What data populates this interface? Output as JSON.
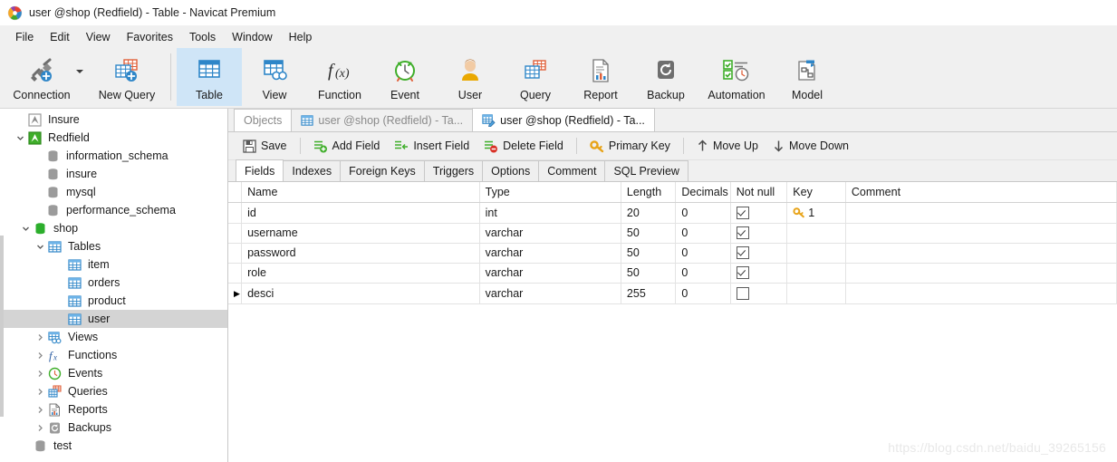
{
  "window": {
    "title": "user @shop (Redfield) - Table - Navicat Premium",
    "app_icon": "navicat-logo-icon"
  },
  "menubar": {
    "items": [
      {
        "label": "File",
        "name": "menu-file"
      },
      {
        "label": "Edit",
        "name": "menu-edit"
      },
      {
        "label": "View",
        "name": "menu-view"
      },
      {
        "label": "Favorites",
        "name": "menu-favorites"
      },
      {
        "label": "Tools",
        "name": "menu-tools"
      },
      {
        "label": "Window",
        "name": "menu-window"
      },
      {
        "label": "Help",
        "name": "menu-help"
      }
    ]
  },
  "toolbar": {
    "buttons": [
      {
        "label": "Connection",
        "icon": "plug-add-icon",
        "active": false
      },
      {
        "label": "New Query",
        "icon": "query-add-icon",
        "active": false
      },
      {
        "label": "Table",
        "icon": "table-icon",
        "active": true
      },
      {
        "label": "View",
        "icon": "view-icon",
        "active": false
      },
      {
        "label": "Function",
        "icon": "function-fx-icon",
        "active": false
      },
      {
        "label": "Event",
        "icon": "clock-icon",
        "active": false
      },
      {
        "label": "User",
        "icon": "user-icon",
        "active": false
      },
      {
        "label": "Query",
        "icon": "query-icon",
        "active": false
      },
      {
        "label": "Report",
        "icon": "report-icon",
        "active": false
      },
      {
        "label": "Backup",
        "icon": "backup-icon",
        "active": false
      },
      {
        "label": "Automation",
        "icon": "automation-icon",
        "active": false
      },
      {
        "label": "Model",
        "icon": "model-icon",
        "active": false
      }
    ]
  },
  "sidebar": {
    "items": [
      {
        "label": "Insure",
        "icon": "connection-gray-icon",
        "indent": 1,
        "twisty": "none",
        "selected": false
      },
      {
        "label": "Redfield",
        "icon": "connection-green-icon",
        "indent": 1,
        "twisty": "open",
        "selected": false
      },
      {
        "label": "information_schema",
        "icon": "database-gray-icon",
        "indent": 2,
        "twisty": "none",
        "selected": false
      },
      {
        "label": "insure",
        "icon": "database-gray-icon",
        "indent": 2,
        "twisty": "none",
        "selected": false
      },
      {
        "label": "mysql",
        "icon": "database-gray-icon",
        "indent": 2,
        "twisty": "none",
        "selected": false
      },
      {
        "label": "performance_schema",
        "icon": "database-gray-icon",
        "indent": 2,
        "twisty": "none",
        "selected": false
      },
      {
        "label": "shop",
        "icon": "database-green-icon",
        "indent": 2,
        "twisty": "open",
        "selected": false
      },
      {
        "label": "Tables",
        "icon": "table-folder-icon",
        "indent": 3,
        "twisty": "open",
        "selected": false
      },
      {
        "label": "item",
        "icon": "table-icon",
        "indent": 4,
        "twisty": "none",
        "selected": false
      },
      {
        "label": "orders",
        "icon": "table-icon",
        "indent": 4,
        "twisty": "none",
        "selected": false
      },
      {
        "label": "product",
        "icon": "table-icon",
        "indent": 4,
        "twisty": "none",
        "selected": false
      },
      {
        "label": "user",
        "icon": "table-icon",
        "indent": 4,
        "twisty": "none",
        "selected": true
      },
      {
        "label": "Views",
        "icon": "view-icon",
        "indent": 3,
        "twisty": "closed",
        "selected": false
      },
      {
        "label": "Functions",
        "icon": "function-fx-icon",
        "indent": 3,
        "twisty": "closed",
        "selected": false
      },
      {
        "label": "Events",
        "icon": "clock-icon",
        "indent": 3,
        "twisty": "closed",
        "selected": false
      },
      {
        "label": "Queries",
        "icon": "query-icon",
        "indent": 3,
        "twisty": "closed",
        "selected": false
      },
      {
        "label": "Reports",
        "icon": "report-icon",
        "indent": 3,
        "twisty": "closed",
        "selected": false
      },
      {
        "label": "Backups",
        "icon": "backup-icon",
        "indent": 3,
        "twisty": "closed",
        "selected": false
      },
      {
        "label": "test",
        "icon": "database-gray-icon",
        "indent": 2,
        "twisty": "none",
        "selected": false
      }
    ]
  },
  "tabs": [
    {
      "label": "Objects",
      "icon": "none",
      "active": false
    },
    {
      "label": "user @shop (Redfield) - Ta...",
      "icon": "table-icon",
      "active": false
    },
    {
      "label": "user @shop (Redfield) - Ta...",
      "icon": "table-design-icon",
      "active": true
    }
  ],
  "edit_toolbar": {
    "buttons": [
      {
        "label": "Save",
        "icon": "save-icon"
      },
      {
        "label": "Add Field",
        "icon": "add-field-icon"
      },
      {
        "label": "Insert Field",
        "icon": "insert-field-icon"
      },
      {
        "label": "Delete Field",
        "icon": "delete-field-icon"
      },
      {
        "label": "Primary Key",
        "icon": "key-icon"
      },
      {
        "label": "Move Up",
        "icon": "arrow-up-icon"
      },
      {
        "label": "Move Down",
        "icon": "arrow-down-icon"
      }
    ]
  },
  "subtabs": [
    {
      "label": "Fields",
      "active": true
    },
    {
      "label": "Indexes",
      "active": false
    },
    {
      "label": "Foreign Keys",
      "active": false
    },
    {
      "label": "Triggers",
      "active": false
    },
    {
      "label": "Options",
      "active": false
    },
    {
      "label": "Comment",
      "active": false
    },
    {
      "label": "SQL Preview",
      "active": false
    }
  ],
  "grid": {
    "columns": [
      "Name",
      "Type",
      "Length",
      "Decimals",
      "Not null",
      "Key",
      "Comment"
    ],
    "rows": [
      {
        "name": "id",
        "type": "int",
        "length": "20",
        "decimals": "0",
        "not_null": true,
        "key": "1",
        "comment": "",
        "current": false
      },
      {
        "name": "username",
        "type": "varchar",
        "length": "50",
        "decimals": "0",
        "not_null": true,
        "key": "",
        "comment": "",
        "current": false
      },
      {
        "name": "password",
        "type": "varchar",
        "length": "50",
        "decimals": "0",
        "not_null": true,
        "key": "",
        "comment": "",
        "current": false
      },
      {
        "name": "role",
        "type": "varchar",
        "length": "50",
        "decimals": "0",
        "not_null": true,
        "key": "",
        "comment": "",
        "current": false
      },
      {
        "name": "desci",
        "type": "varchar",
        "length": "255",
        "decimals": "0",
        "not_null": false,
        "key": "",
        "comment": "",
        "current": true
      }
    ]
  },
  "watermark": "https://blog.csdn.net/baidu_39265156",
  "colors": {
    "accent": "#cfe5f7",
    "selection": "#d4d4d4",
    "key_gold": "#e8a317",
    "green": "#3fae2a",
    "blue": "#2e86c8"
  }
}
